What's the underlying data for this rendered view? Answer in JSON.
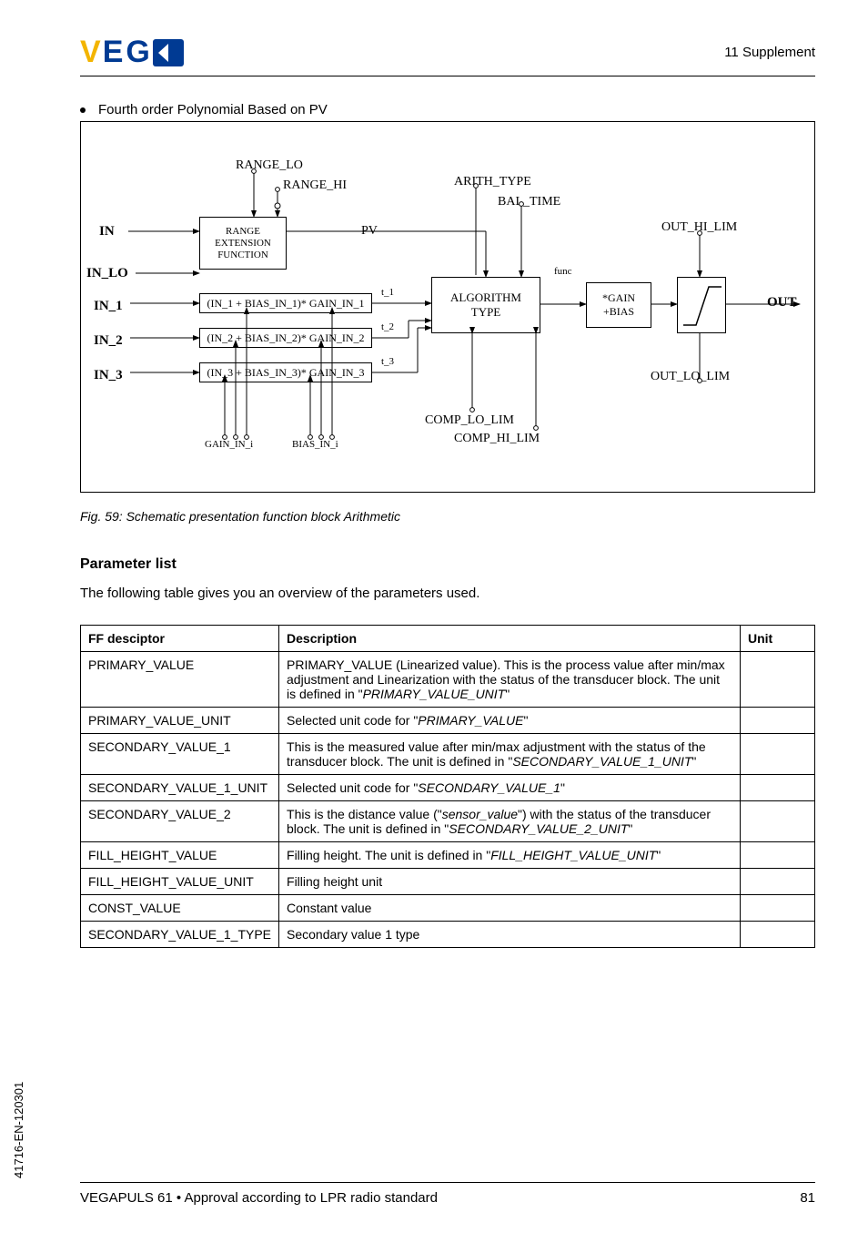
{
  "header": {
    "supplement": "11   Supplement"
  },
  "bullet": {
    "text": "Fourth order Polynomial Based on PV"
  },
  "figure": {
    "caption": "Fig. 59: Schematic presentation function block Arithmetic",
    "labels": {
      "range_lo": "RANGE_LO",
      "range_hi": "RANGE_HI",
      "arith_type": "ARITH_TYPE",
      "bal_time": "BAL_TIME",
      "in": "IN",
      "range": "RANGE",
      "extension": "EXTENSION",
      "function": "FUNCTION",
      "pv": "PV",
      "out_hi_lim": "OUT_HI_LIM",
      "in_lo": "IN_LO",
      "func": "func",
      "in_1": "IN_1",
      "in_2": "IN_2",
      "in_3": "IN_3",
      "formula1": "(IN_1 + BIAS_IN_1)* GAIN_IN_1",
      "formula2": "(IN_2 + BIAS_IN_2)* GAIN_IN_2",
      "formula3": "(IN_3 + BIAS_IN_3)* GAIN_IN_3",
      "t1": "t_1",
      "t2": "t_2",
      "t3": "t_3",
      "algorithm": "ALGORITHM",
      "type": "TYPE",
      "gain": "*GAIN",
      "bias": "+BIAS",
      "out": "OUT",
      "out_lo_lim": "OUT_LO_LIM",
      "comp_lo_lim": "COMP_LO_LIM",
      "comp_hi_lim": "COMP_HI_LIM",
      "gain_in_i": "GAIN_IN_i",
      "bias_in_i": "BIAS_IN_i"
    }
  },
  "section": {
    "heading": "Parameter list",
    "intro": "The following table gives you an overview of the parameters used."
  },
  "table": {
    "headers": {
      "ff": "FF desciptor",
      "desc": "Description",
      "unit": "Unit"
    },
    "rows": [
      {
        "ff": "PRIMARY_VALUE",
        "desc_pre": "PRIMARY_VALUE (Linearized value). This is the process value after min/max adjustment and Linearization with the status of the transducer block. The unit is defined in \"",
        "desc_ital": "PRIMARY_VALUE_UNIT",
        "desc_post": "\""
      },
      {
        "ff": "PRIMARY_VALUE_UNIT",
        "desc_pre": "Selected unit code for \"",
        "desc_ital": "PRIMARY_VALUE",
        "desc_post": "\""
      },
      {
        "ff": "SECONDARY_VALUE_1",
        "desc_pre": "This is the measured value after min/max adjustment with the status of the transducer block. The unit is defined in \"",
        "desc_ital": "SECONDARY_VALUE_1_UNIT",
        "desc_post": "\""
      },
      {
        "ff": "SECONDARY_VALUE_1_UNIT",
        "desc_pre": "Selected unit code for \"",
        "desc_ital": "SECONDARY_VALUE_1",
        "desc_post": "\""
      },
      {
        "ff": "SECONDARY_VALUE_2",
        "desc_pre": "This is the distance value (\"",
        "desc_ital": "sensor_value",
        "desc_mid": "\") with the status of the transducer block. The unit is defined in \"",
        "desc_ital2": "SECONDARY_VALUE_2_UNIT",
        "desc_post": "\""
      },
      {
        "ff": "FILL_HEIGHT_VALUE",
        "desc_pre": "Filling height. The unit is defined in \"",
        "desc_ital": "FILL_HEIGHT_VALUE_UNIT",
        "desc_post": "\""
      },
      {
        "ff": "FILL_HEIGHT_VALUE_UNIT",
        "desc_plain": "Filling height unit"
      },
      {
        "ff": "CONST_VALUE",
        "desc_plain": "Constant value"
      },
      {
        "ff": "SECONDARY_VALUE_1_TYPE",
        "desc_plain": "Secondary value 1 type"
      }
    ]
  },
  "side": {
    "doc_id": "41716-EN-120301"
  },
  "footer": {
    "text": "VEGAPULS 61 • Approval according to LPR radio standard",
    "page": "81"
  },
  "chart_data": {
    "type": "diagram",
    "title": "Arithmetic function block",
    "inputs": [
      "IN",
      "IN_LO",
      "IN_1",
      "IN_2",
      "IN_3"
    ],
    "parameters": [
      "RANGE_LO",
      "RANGE_HI",
      "ARITH_TYPE",
      "BAL_TIME",
      "OUT_HI_LIM",
      "OUT_LO_LIM",
      "COMP_LO_LIM",
      "COMP_HI_LIM",
      "GAIN_IN_i",
      "BIAS_IN_i"
    ],
    "stages": [
      "RANGE EXTENSION FUNCTION",
      "(IN_1 + BIAS_IN_1)* GAIN_IN_1",
      "(IN_2 + BIAS_IN_2)* GAIN_IN_2",
      "(IN_3 + BIAS_IN_3)* GAIN_IN_3",
      "ALGORITHM TYPE",
      "*GAIN +BIAS",
      "limiter"
    ],
    "intermediate": [
      "PV",
      "func",
      "t_1",
      "t_2",
      "t_3"
    ],
    "output": "OUT"
  }
}
